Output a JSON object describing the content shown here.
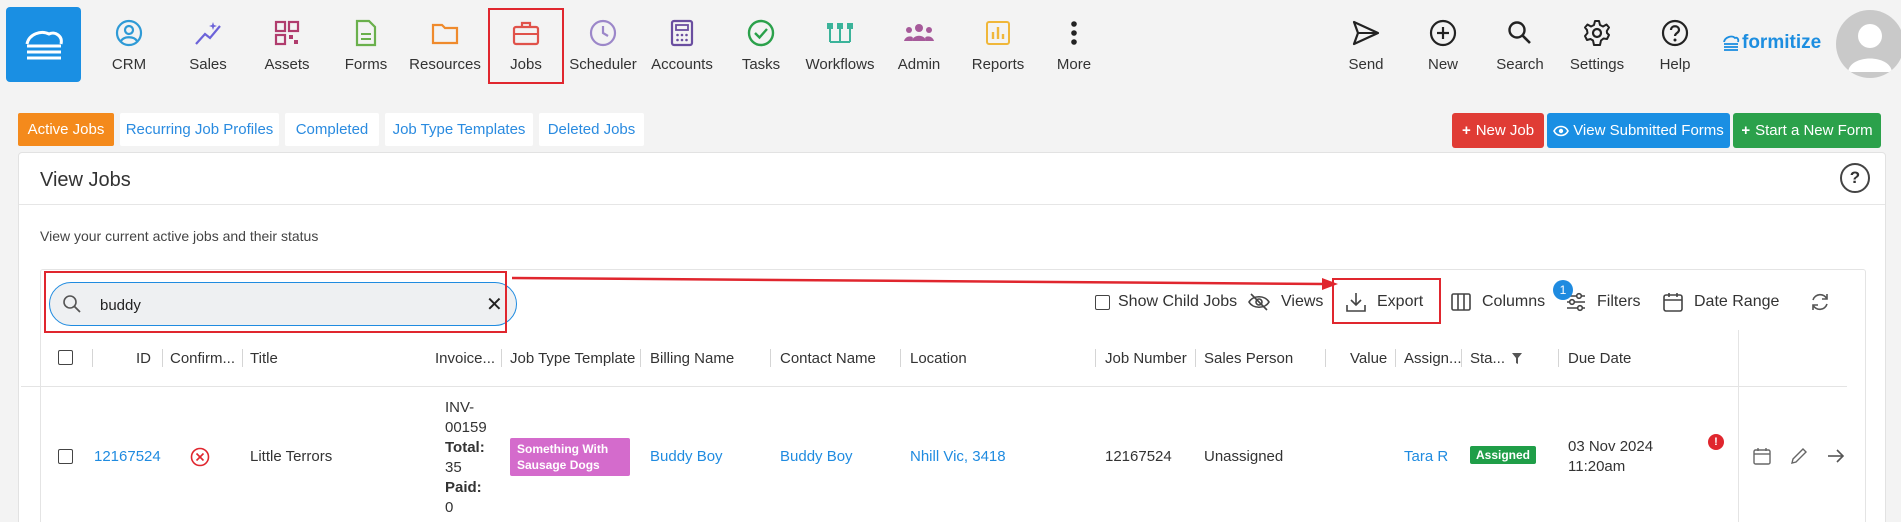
{
  "nav": {
    "items": [
      {
        "label": "CRM",
        "icon": "person-circle-icon"
      },
      {
        "label": "Sales",
        "icon": "sparkle-trend-icon"
      },
      {
        "label": "Assets",
        "icon": "qr-grid-icon"
      },
      {
        "label": "Forms",
        "icon": "document-icon"
      },
      {
        "label": "Resources",
        "icon": "folder-icon"
      },
      {
        "label": "Jobs",
        "icon": "briefcase-icon"
      },
      {
        "label": "Scheduler",
        "icon": "clock-icon"
      },
      {
        "label": "Accounts",
        "icon": "calculator-icon"
      },
      {
        "label": "Tasks",
        "icon": "check-circle-icon"
      },
      {
        "label": "Workflows",
        "icon": "workflow-icon"
      },
      {
        "label": "Admin",
        "icon": "people-icon"
      },
      {
        "label": "Reports",
        "icon": "bar-chart-icon"
      },
      {
        "label": "More",
        "icon": "vertical-dots-icon"
      }
    ],
    "right": [
      {
        "label": "Send",
        "icon": "send-icon"
      },
      {
        "label": "New",
        "icon": "plus-circle-icon"
      },
      {
        "label": "Search",
        "icon": "search-icon"
      },
      {
        "label": "Settings",
        "icon": "gear-icon"
      },
      {
        "label": "Help",
        "icon": "question-circle-icon"
      }
    ],
    "brand": "formitize",
    "active": "Jobs"
  },
  "tabs": [
    "Active Jobs",
    "Recurring Job Profiles",
    "Completed",
    "Job Type Templates",
    "Deleted Jobs"
  ],
  "actions": {
    "new_job": "New Job",
    "view_submitted": "View Submitted Forms",
    "start_form": "Start a New Form"
  },
  "page": {
    "title": "View Jobs",
    "description": "View your current active jobs and their status",
    "help": "?"
  },
  "search": {
    "value": "buddy",
    "clear": "✕"
  },
  "toolbar": {
    "show_child_jobs": "Show Child Jobs",
    "views": "Views",
    "export": "Export",
    "columns": "Columns",
    "filters": "Filters",
    "filters_count": "1",
    "date_range": "Date Range"
  },
  "columns": [
    "ID",
    "Confirm...",
    "Title",
    "Invoice...",
    "Job Type Template",
    "Billing Name",
    "Contact Name",
    "Location",
    "Job Number",
    "Sales Person",
    "Value",
    "Assign...",
    "Sta...",
    "Due Date"
  ],
  "row": {
    "id": "12167524",
    "title": "Little Terrors",
    "invoice_no": "INV-",
    "invoice_no2": "00159",
    "total_label": "Total:",
    "total": "35",
    "paid_label": "Paid:",
    "paid": "0",
    "job_type": "Something With Sausage Dogs",
    "job_type_line1": "Something With",
    "job_type_line2": "Sausage Dogs",
    "billing_name": "Buddy Boy",
    "contact_name": "Buddy Boy",
    "location": "Nhill Vic, 3418",
    "job_number": "12167524",
    "sales_person": "Unassigned",
    "assigned": "Tara R",
    "status": "Assigned",
    "due_date": "03 Nov 2024",
    "due_time": "11:20am",
    "alert": "!"
  },
  "colors": {
    "brand": "#1a8fe3",
    "active_tab": "#f48a1c",
    "new_job": "#e03c35",
    "view_submitted": "#1a8fe3",
    "start_form": "#2ba14b",
    "job_type_badge": "#d46bcc",
    "status_badge": "#1f9e48",
    "highlight": "#e0262e"
  }
}
